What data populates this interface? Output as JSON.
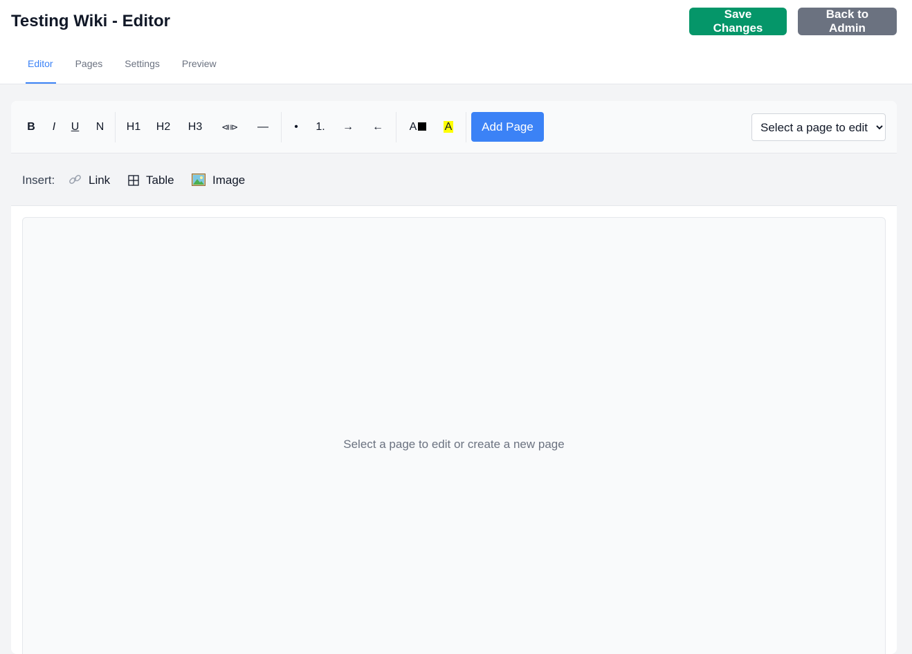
{
  "header": {
    "title": "Testing Wiki - Editor",
    "save_label": "Save Changes",
    "back_label": "Back to Admin"
  },
  "tabs": [
    {
      "label": "Editor",
      "active": true
    },
    {
      "label": "Pages",
      "active": false
    },
    {
      "label": "Settings",
      "active": false
    },
    {
      "label": "Preview",
      "active": false
    }
  ],
  "toolbar": {
    "bold": "B",
    "italic": "I",
    "underline": "U",
    "normal": "N",
    "h1": "H1",
    "h2": "H2",
    "h3": "H3",
    "code": "⧏⧐",
    "hr": "—",
    "bullet": "•",
    "numbered": "1.",
    "indent": "→",
    "outdent": "←",
    "text_color": "A",
    "highlight": "A",
    "add_page": "Add Page",
    "page_select": {
      "selected": "Select a page to edit",
      "options": [
        "Select a page to edit"
      ]
    }
  },
  "insert": {
    "label": "Insert:",
    "link": "Link",
    "table": "Table",
    "image": "Image"
  },
  "editor": {
    "placeholder": "Select a page to edit or create a new page"
  },
  "colors": {
    "accent": "#3b82f6",
    "save": "#059669",
    "back": "#6b7280",
    "highlight": "#ffff00"
  }
}
